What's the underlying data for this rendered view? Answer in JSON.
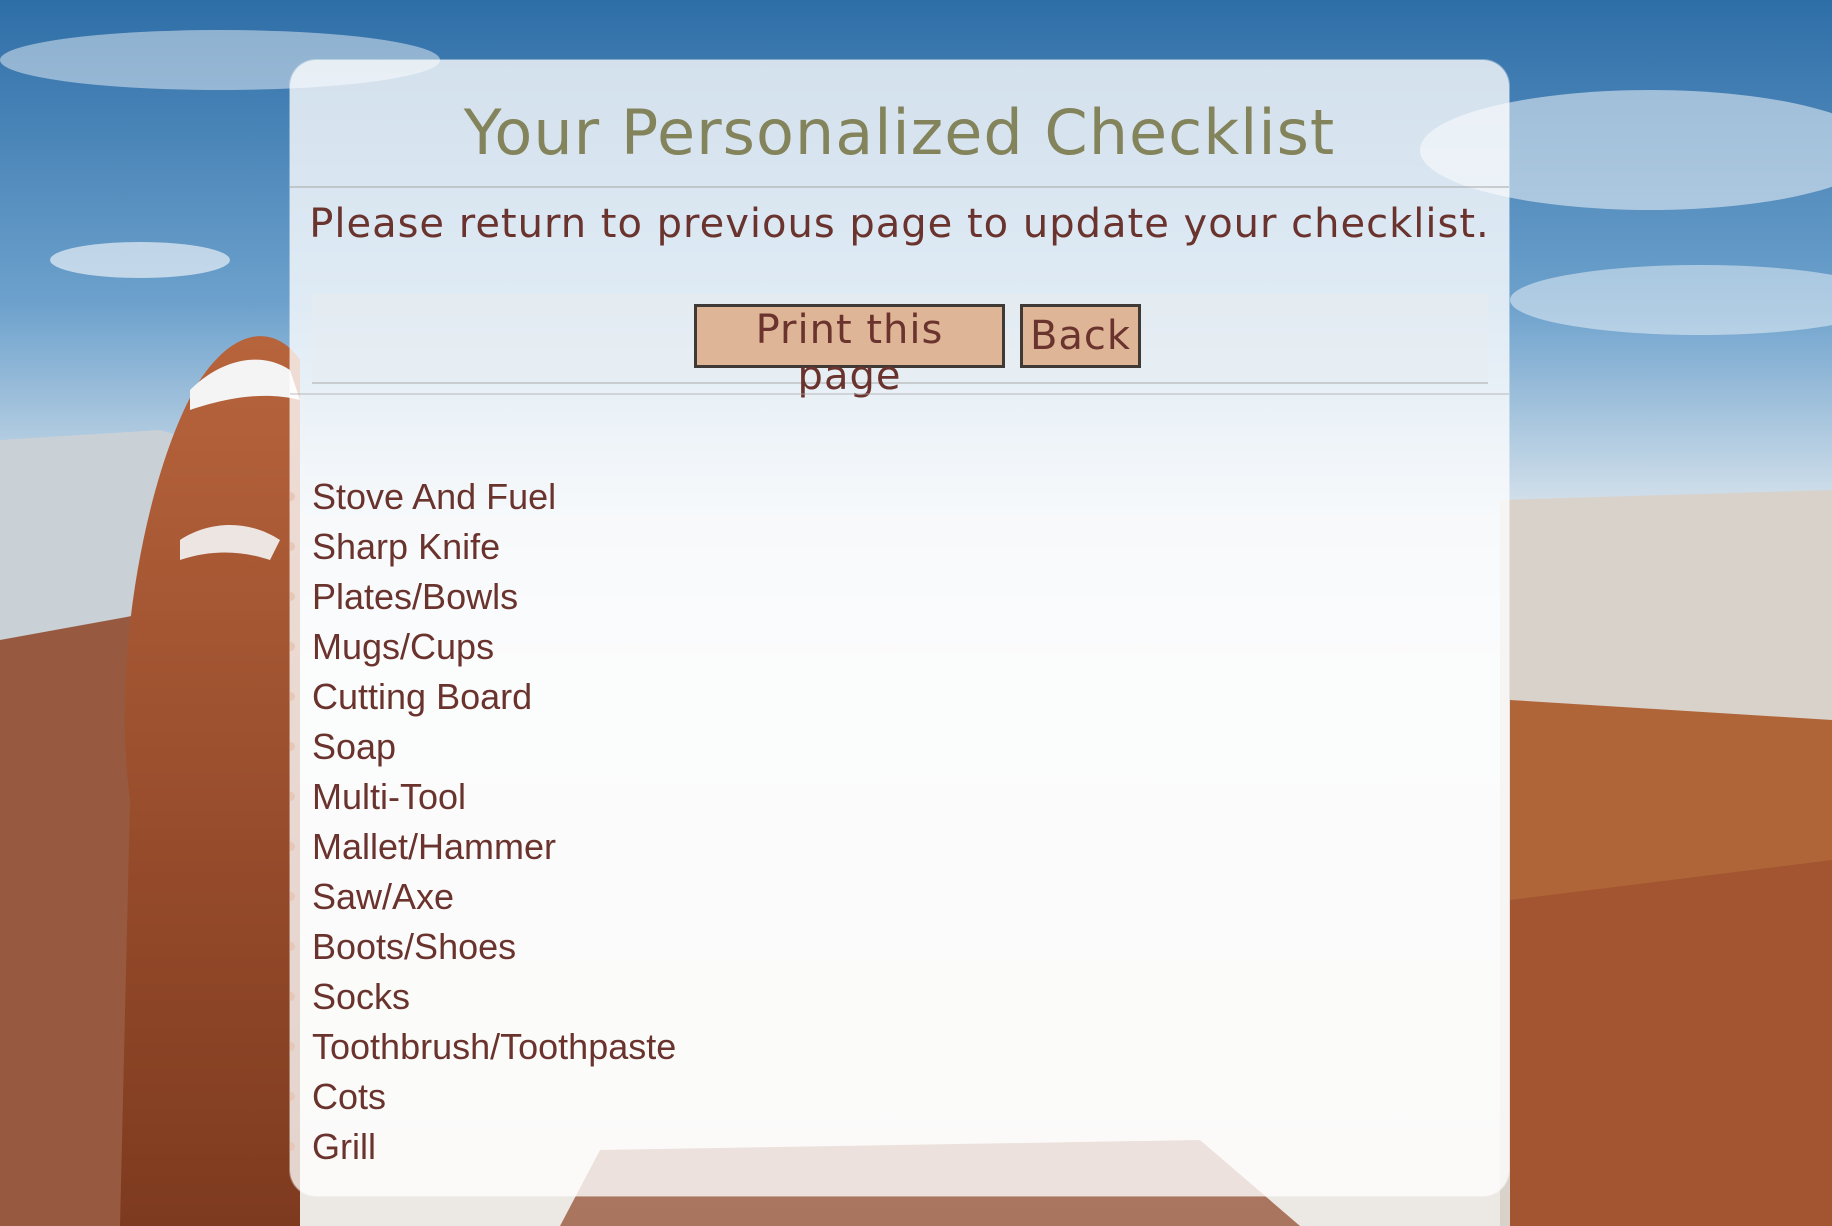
{
  "page": {
    "title": "Your Personalized Checklist",
    "subtitle": "Please return to previous page to update your checklist."
  },
  "actions": {
    "print_label": "Print this page",
    "back_label": "Back"
  },
  "checklist": {
    "items": [
      "Stove And Fuel",
      "Sharp Knife",
      "Plates/Bowls",
      "Mugs/Cups",
      "Cutting Board",
      "Soap",
      "Multi-Tool",
      "Mallet/Hammer",
      "Saw/Axe",
      "Boots/Shoes",
      "Socks",
      "Toothbrush/Toothpaste",
      "Cots",
      "Grill"
    ]
  },
  "colors": {
    "title": "#83845c",
    "text": "#6a332d",
    "button_fill": "#dfb597",
    "button_border": "#3f3a36",
    "bullet": "#e7c7b7"
  }
}
